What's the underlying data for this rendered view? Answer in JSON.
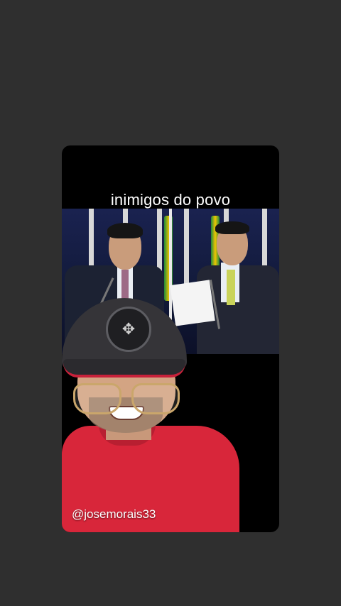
{
  "story": {
    "caption": "inimigos do povo",
    "handle": "@josemorais33"
  },
  "icons": {
    "cap_badge": "compass-emblem-icon"
  },
  "colors": {
    "background": "#2f2f2f",
    "card": "#000000",
    "shirt_red": "#d8263a"
  }
}
